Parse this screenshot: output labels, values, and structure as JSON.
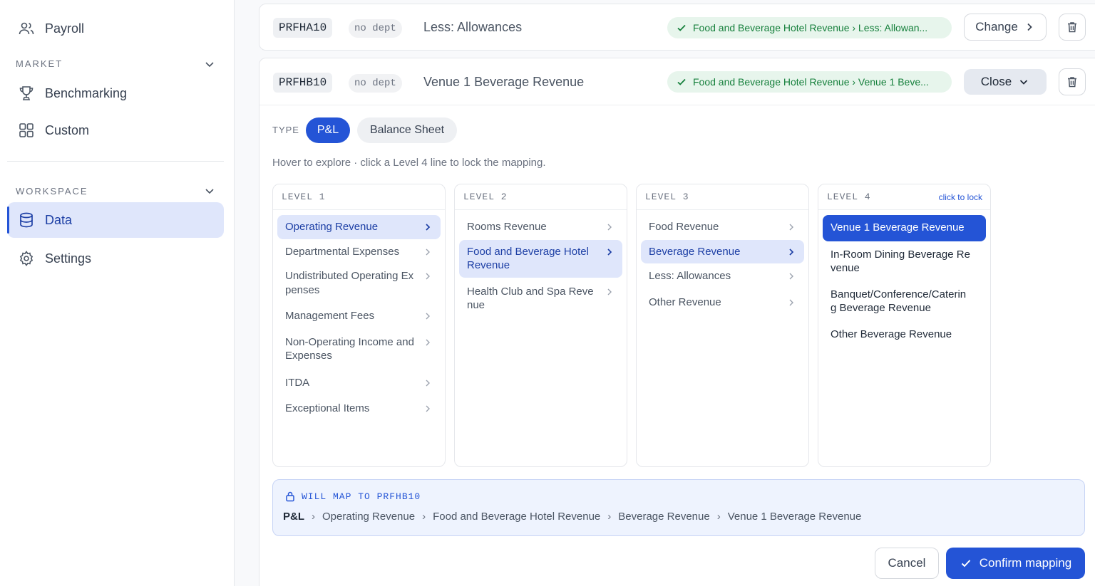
{
  "sidebar": {
    "payroll": "Payroll",
    "market_label": "MARKET",
    "benchmarking": "Benchmarking",
    "custom": "Custom",
    "workspace_label": "WORKSPACE",
    "data": "Data",
    "settings": "Settings"
  },
  "rows": [
    {
      "code": "PRFHA10",
      "dept": "no dept",
      "name": "Less: Allowances",
      "mapping": "Food and Beverage Hotel Revenue › Less: Allowan...",
      "action": "Change"
    },
    {
      "code": "PRFHB10",
      "dept": "no dept",
      "name": "Venue 1 Beverage Revenue",
      "mapping": "Food and Beverage Hotel Revenue › Venue 1 Beve...",
      "action": "Close"
    }
  ],
  "type": {
    "label": "TYPE",
    "options": [
      "P&L",
      "Balance Sheet"
    ],
    "selected": "P&L"
  },
  "hint": "Hover to explore · click a Level 4 line to lock the mapping.",
  "levels": [
    {
      "title": "LEVEL 1",
      "items": [
        "Operating Revenue",
        "Departmental Expenses",
        "Undistributed Operating Expenses",
        "Management Fees",
        "Non-Operating Income and Expenses",
        "ITDA",
        "Exceptional Items"
      ]
    },
    {
      "title": "LEVEL 2",
      "items": [
        "Rooms Revenue",
        "Food and Beverage Hotel Revenue",
        "Health Club and Spa Revenue"
      ]
    },
    {
      "title": "LEVEL 3",
      "items": [
        "Food Revenue",
        "Beverage Revenue",
        "Less: Allowances",
        "Other Revenue"
      ]
    },
    {
      "title": "LEVEL 4",
      "lock_hint": "click to lock",
      "items": [
        "Venue 1 Beverage Revenue",
        "In-Room Dining Beverage Revenue",
        "Banquet/Conference/Catering Beverage Revenue",
        "Other Beverage Revenue"
      ]
    }
  ],
  "will_map": {
    "label": "WILL MAP TO PRFHB10",
    "path": [
      "P&L",
      "Operating Revenue",
      "Food and Beverage Hotel Revenue",
      "Beverage Revenue",
      "Venue 1 Beverage Revenue"
    ]
  },
  "actions": {
    "cancel": "Cancel",
    "confirm": "Confirm mapping"
  },
  "colors": {
    "accent": "#2454d6",
    "selected_bg": "#dfe6fb",
    "success_text": "#16803c",
    "success_bg": "#e7f5ec"
  }
}
